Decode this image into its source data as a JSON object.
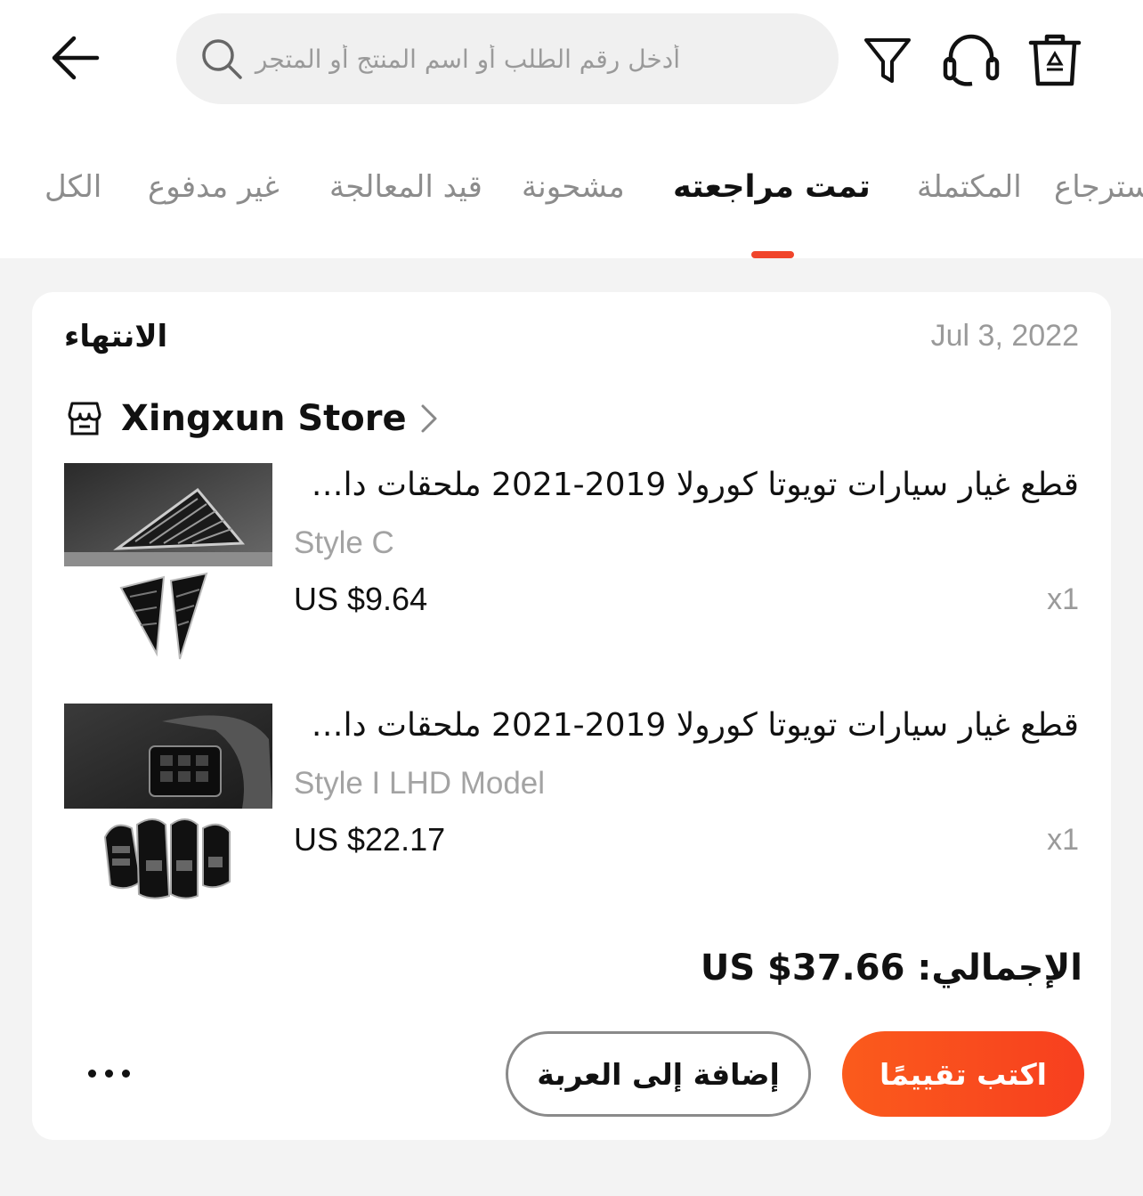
{
  "header": {
    "search_placeholder": "أدخل رقم الطلب أو اسم المنتج أو المتجر"
  },
  "tabs": [
    {
      "label": "الكل",
      "active": false
    },
    {
      "label": "غير مدفوع",
      "active": false
    },
    {
      "label": "قيد المعالجة",
      "active": false
    },
    {
      "label": "مشحونة",
      "active": false
    },
    {
      "label": "تمت مراجعته",
      "active": true
    },
    {
      "label": "المكتملة",
      "active": false
    },
    {
      "label": "استرجاع",
      "active": false
    }
  ],
  "order": {
    "status": "الانتهاء",
    "date": "Jul 3, 2022",
    "store_name": "Xingxun Store",
    "items": [
      {
        "title": "قطع غيار سيارات تويوتا كورولا 2019-2021 ملحقات داخل...",
        "variant": "Style C",
        "price": "US $9.64",
        "qty": "x1"
      },
      {
        "title": "قطع غيار سيارات تويوتا كورولا 2019-2021 ملحقات داخل...",
        "variant": "Style I LHD Model",
        "price": "US $22.17",
        "qty": "x1"
      }
    ],
    "total": "الإجمالي: US $37.66",
    "add_to_cart_label": "إضافة إلى العربة",
    "write_review_label": "اكتب تقييمًا"
  },
  "colors": {
    "accent": "#f0452b",
    "review_button": "#fb5b1c",
    "muted_text": "#9a9a9a"
  }
}
